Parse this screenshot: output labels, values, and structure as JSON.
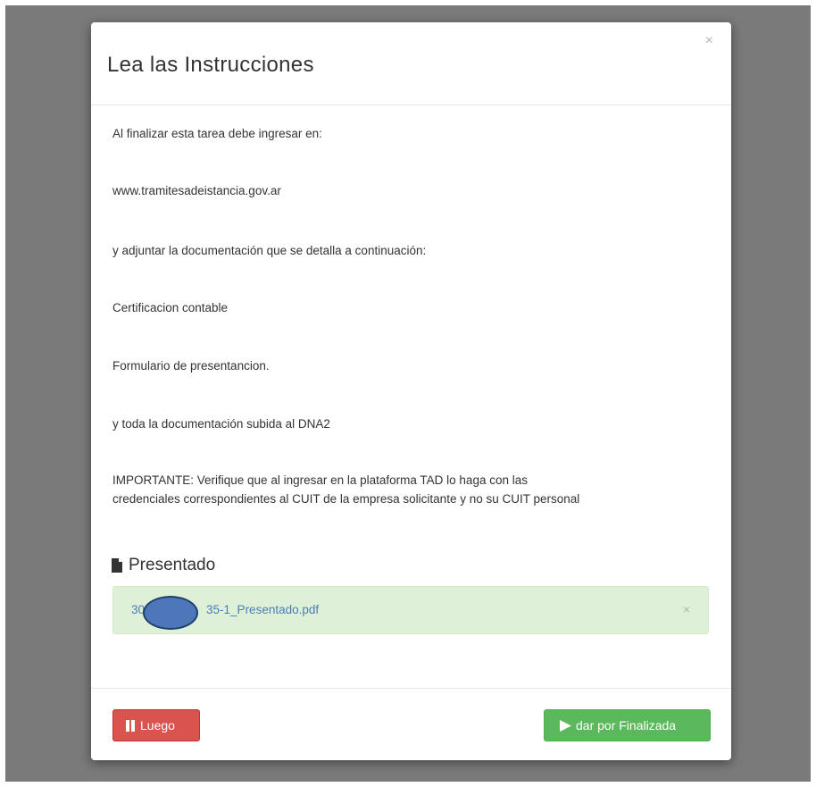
{
  "modal": {
    "title": "Lea las Instrucciones",
    "close_glyph": "×"
  },
  "instructions": [
    "Al finalizar esta tarea debe ingresar en:",
    "www.tramitesadeistancia.gov.ar",
    "y adjuntar la documentación que se detalla a continuación:",
    "Certificacion contable",
    "Formulario de presentancion.",
    "y toda la documentación subida al DNA2",
    "IMPORTANTE: Verifique que al ingresar en la plataforma TAD lo haga con las",
    "credenciales correspondientes al CUIT de la empresa solicitante y no su CUIT personal"
  ],
  "attachments": {
    "section_title": "Presentado",
    "section_icon": "file-icon",
    "file_prefix": "30",
    "file_suffix": "35-1_Presentado.pdf",
    "remove_glyph": "×"
  },
  "footer": {
    "later_label": "Luego",
    "later_icon": "pause-icon",
    "finish_label": "dar por Finalizada",
    "finish_icon": "play-icon"
  },
  "colors": {
    "danger": "#d9534f",
    "success": "#5cb85c",
    "success_bg": "#dff0d8",
    "link": "#4a7fb5",
    "redaction": "#4d77b8"
  }
}
